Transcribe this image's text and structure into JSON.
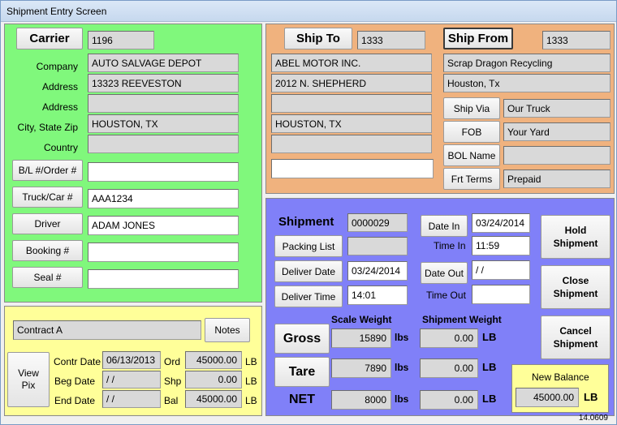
{
  "window": {
    "title": "Shipment Entry Screen",
    "version": "14.0609"
  },
  "carrier": {
    "button_label": "Carrier",
    "id": "1196",
    "labels": {
      "company": "Company",
      "address1": "Address",
      "address2": "Address",
      "city": "City, State Zip",
      "country": "Country"
    },
    "company": "AUTO SALVAGE DEPOT",
    "address1": "13323 REEVESTON",
    "address2": "",
    "city": "HOUSTON, TX",
    "country": "",
    "bl_label": "B/L #/Order #",
    "bl_value": "",
    "truck_label": "Truck/Car #",
    "truck_value": "AAA1234",
    "driver_label": "Driver",
    "driver_value": "ADAM JONES",
    "booking_label": "Booking #",
    "booking_value": "",
    "seal_label": "Seal #",
    "seal_value": ""
  },
  "contract": {
    "name": "Contract A",
    "notes_label": "Notes",
    "view_pix_label": "View Pix",
    "contr_date_label": "Contr Date",
    "contr_date": "06/13/2013",
    "beg_date_label": "Beg Date",
    "beg_date": " / /",
    "end_date_label": "End Date",
    "end_date": " / /",
    "ord_label": "Ord",
    "ord": "45000.00",
    "shp_label": "Shp",
    "shp": "0.00",
    "bal_label": "Bal",
    "bal": "45000.00",
    "unit": "LB"
  },
  "ship_to": {
    "button_label": "Ship To",
    "id": "1333",
    "line1": "ABEL MOTOR INC.",
    "line2": "2012 N. SHEPHERD",
    "line3": "",
    "line4": "HOUSTON, TX",
    "line5": "",
    "line6": ""
  },
  "ship_from": {
    "button_label": "Ship From",
    "id": "1333",
    "line1": "Scrap Dragon Recycling",
    "line2": "Houston, Tx",
    "ship_via_label": "Ship Via",
    "ship_via": "Our Truck",
    "fob_label": "FOB",
    "fob": "Your Yard",
    "bol_label": "BOL Name",
    "bol": "",
    "frt_label": "Frt Terms",
    "frt": "Prepaid"
  },
  "shipment": {
    "label": "Shipment",
    "number": "0000029",
    "packing_list_label": "Packing List",
    "packing_list": "",
    "deliver_date_label": "Deliver Date",
    "deliver_date": "03/24/2014",
    "deliver_time_label": "Deliver Time",
    "deliver_time": "14:01",
    "date_in_label": "Date In",
    "date_in": "03/24/2014",
    "time_in_label": "Time In",
    "time_in": "11:59",
    "date_out_label": "Date Out",
    "date_out": " / /",
    "time_out_label": "Time Out",
    "time_out": "",
    "hold_label": "Hold Shipment",
    "close_label": "Close Shipment",
    "cancel_label": "Cancel Shipment",
    "scale_weight_header": "Scale Weight",
    "shipment_weight_header": "Shipment Weight",
    "gross_label": "Gross",
    "gross_scale": "15890",
    "gross_ship": "0.00",
    "tare_label": "Tare",
    "tare_scale": "7890",
    "tare_ship": "0.00",
    "net_label": "NET",
    "net_scale": "8000",
    "net_ship": "0.00",
    "lbs": "lbs",
    "lb": "LB",
    "new_balance_label": "New Balance",
    "new_balance": "45000.00",
    "new_balance_unit": "LB"
  }
}
